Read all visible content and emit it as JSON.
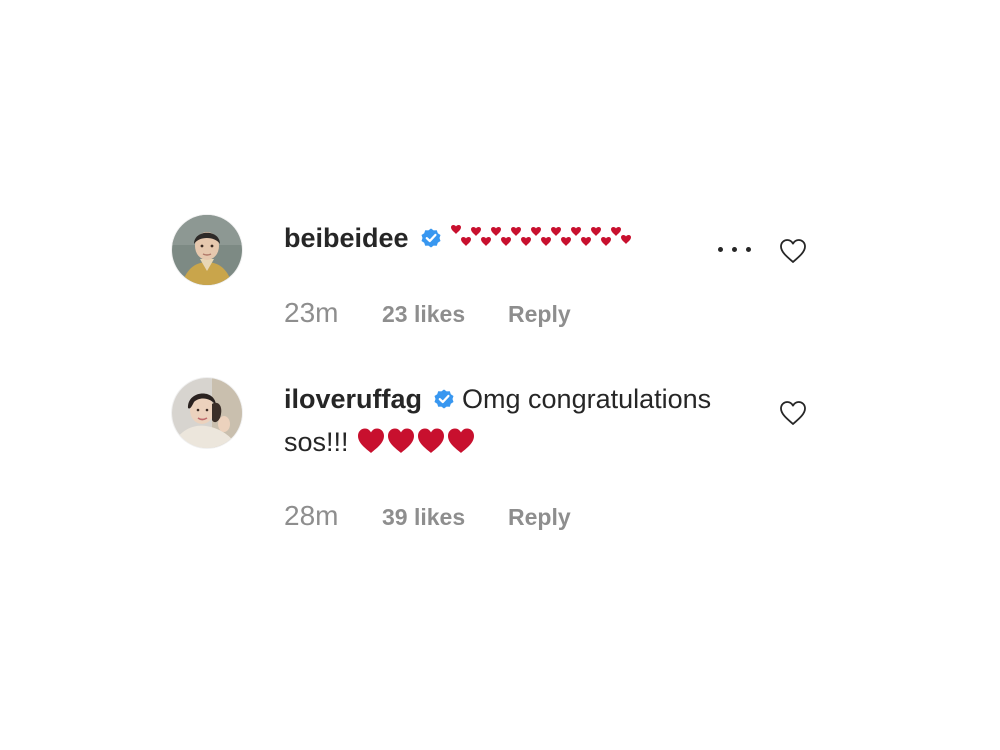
{
  "comments": [
    {
      "username": "beibeidee",
      "verified": true,
      "text": "",
      "emoji": "small-red-hearts",
      "time": "23m",
      "likes": "23 likes",
      "reply": "Reply"
    },
    {
      "username": "iloveruffag",
      "verified": true,
      "text": "Omg congratulations sos!!!",
      "emoji": "red-heart x4",
      "time": "28m",
      "likes": "39 likes",
      "reply": "Reply"
    }
  ],
  "colors": {
    "text": "#262626",
    "meta": "#8e8e8e",
    "verified": "#3897f0",
    "heart_emoji": "#c8102e"
  },
  "icons": {
    "verified": "verified-badge-icon",
    "more": "more-options-icon",
    "like": "heart-outline-icon"
  }
}
